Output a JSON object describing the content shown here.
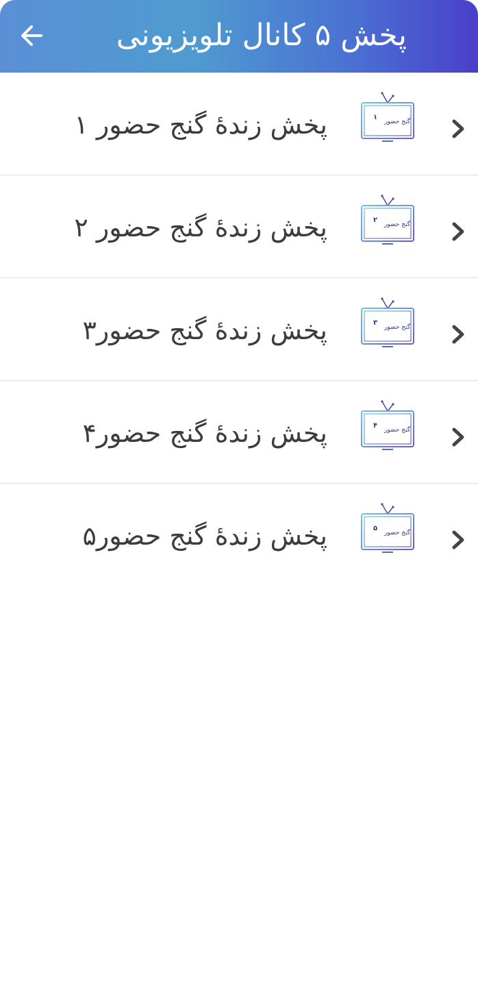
{
  "header": {
    "title": "پخش ۵ کانال تلویزیونی",
    "back_icon": "arrow-left-icon",
    "gradient_colors": [
      "#5a8fd6",
      "#4f9bd0",
      "#4a3fca"
    ]
  },
  "channels": [
    {
      "label": "پخش زندهٔ گنج حضور ۱",
      "logo_text": "گنج حضور",
      "logo_number": "۱"
    },
    {
      "label": "پخش زندهٔ گنج حضور ۲",
      "logo_text": "گنج حضور",
      "logo_number": "۲"
    },
    {
      "label": "پخش زندهٔ گنج حضور۳",
      "logo_text": "گنج حضور",
      "logo_number": "۳"
    },
    {
      "label": "پخش زندهٔ گنج حضور۴",
      "logo_text": "گنج حضور",
      "logo_number": "۴"
    },
    {
      "label": "پخش زندهٔ گنج حضور۵",
      "logo_text": "گنج حضور",
      "logo_number": "۵"
    }
  ],
  "icons": {
    "row_chevron": "chevron-right-icon",
    "row_logo": "tv-icon"
  }
}
